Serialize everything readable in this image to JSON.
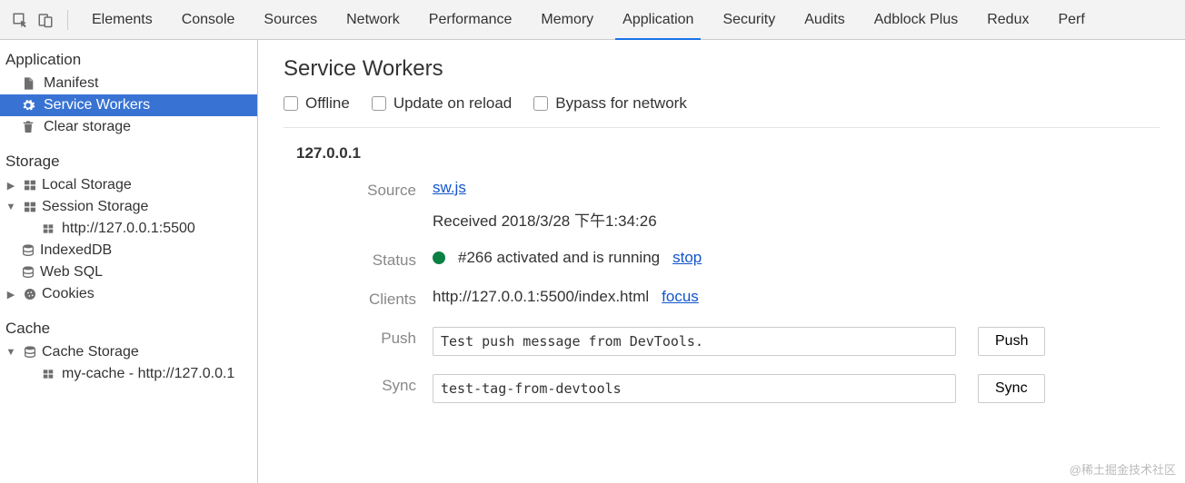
{
  "tabs": [
    "Elements",
    "Console",
    "Sources",
    "Network",
    "Performance",
    "Memory",
    "Application",
    "Security",
    "Audits",
    "Adblock Plus",
    "Redux",
    "Perf"
  ],
  "active_tab": "Application",
  "sidebar": {
    "groups": [
      {
        "title": "Application",
        "items": [
          {
            "label": "Manifest",
            "icon": "file"
          },
          {
            "label": "Service Workers",
            "icon": "gear",
            "selected": true
          },
          {
            "label": "Clear storage",
            "icon": "trash"
          }
        ]
      },
      {
        "title": "Storage",
        "tree": [
          {
            "label": "Local Storage",
            "icon": "grid",
            "expanded": false,
            "children": []
          },
          {
            "label": "Session Storage",
            "icon": "grid",
            "expanded": true,
            "children": [
              {
                "label": "http://127.0.0.1:5500",
                "icon": "grid"
              }
            ]
          },
          {
            "label": "IndexedDB",
            "icon": "db"
          },
          {
            "label": "Web SQL",
            "icon": "db"
          },
          {
            "label": "Cookies",
            "icon": "cookie",
            "expanded": false,
            "children": []
          }
        ]
      },
      {
        "title": "Cache",
        "tree": [
          {
            "label": "Cache Storage",
            "icon": "db",
            "expanded": true,
            "children": [
              {
                "label": "my-cache - http://127.0.0.1",
                "icon": "grid"
              }
            ]
          }
        ]
      }
    ]
  },
  "panel": {
    "title": "Service Workers",
    "checks": [
      {
        "label": "Offline"
      },
      {
        "label": "Update on reload"
      },
      {
        "label": "Bypass for network"
      }
    ],
    "origin": "127.0.0.1",
    "rows": {
      "source": {
        "label": "Source",
        "link": "sw.js",
        "received": "Received 2018/3/28 下午1:34:26"
      },
      "status": {
        "label": "Status",
        "text": "#266 activated and is running",
        "action": "stop"
      },
      "clients": {
        "label": "Clients",
        "text": "http://127.0.0.1:5500/index.html",
        "action": "focus"
      },
      "push": {
        "label": "Push",
        "value": "Test push message from DevTools.",
        "button": "Push"
      },
      "sync": {
        "label": "Sync",
        "value": "test-tag-from-devtools",
        "button": "Sync"
      }
    }
  },
  "watermark": "@稀土掘金技术社区"
}
